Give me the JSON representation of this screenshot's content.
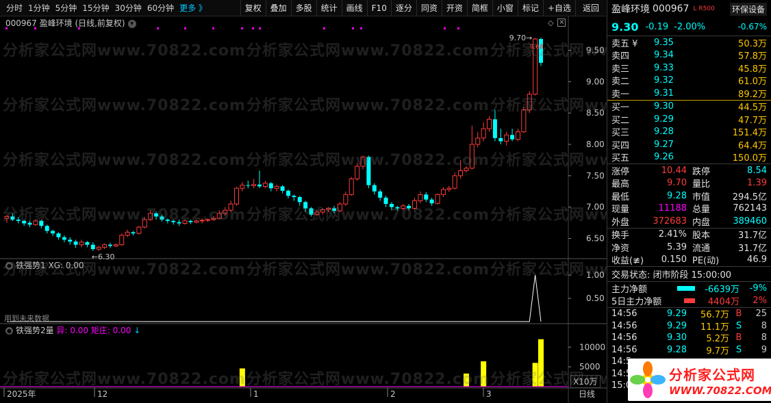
{
  "toolbar": {
    "periods": [
      "分时",
      "1分钟",
      "5分钟",
      "15分钟",
      "30分钟",
      "60分钟",
      "更多 》"
    ],
    "buttons": [
      "复权",
      "叠加",
      "多股",
      "统计",
      "画线",
      "F10",
      "逐分",
      "同资",
      "开资",
      "简框",
      "小窗",
      "标记",
      "+自选",
      "返回"
    ]
  },
  "chart_header": {
    "code_name": "000967 盈峰环境 (日线,前复权)",
    "dropdown_icon": "chevron-down-icon"
  },
  "watermark_text": "分析家公式网www.70822.com",
  "annotations": {
    "high": "9.70",
    "low": "6.30",
    "last": "9.68"
  },
  "indicator1": {
    "name": "铁强势1",
    "value_label": "XG: 0.00",
    "note": "用到未来数据",
    "axis": [
      "1.00",
      "0.50"
    ]
  },
  "indicator2": {
    "name": "铁强势2量",
    "v1": "异: 0.00",
    "v2": "矩庄: 0.00",
    "arrow": "↓",
    "axis": [
      "10000",
      "5000"
    ],
    "unit": "X10万"
  },
  "x_axis": {
    "labels": [
      "2025年",
      "12",
      "1",
      "2",
      "3"
    ],
    "period": "日线"
  },
  "colors": {
    "up": "#ff3c3c",
    "down": "#00ffff",
    "bg": "#000000",
    "volume": "#ffff00",
    "signal": "#ffffff",
    "accent": "#00c8ff"
  },
  "chart_data": {
    "type": "candlestick",
    "ylim": [
      6.2,
      9.8
    ],
    "y_ticks": [
      "9.50",
      "9.00",
      "8.50",
      "8.00",
      "7.50",
      "7.00",
      "6.50"
    ],
    "candles": [
      [
        6.82,
        6.85,
        6.75,
        6.88
      ],
      [
        6.85,
        6.8,
        6.78,
        6.9
      ],
      [
        6.8,
        6.78,
        6.74,
        6.84
      ],
      [
        6.78,
        6.74,
        6.7,
        6.8
      ],
      [
        6.75,
        6.72,
        6.68,
        6.78
      ],
      [
        6.72,
        6.78,
        6.7,
        6.8
      ],
      [
        6.78,
        6.7,
        6.66,
        6.8
      ],
      [
        6.7,
        6.62,
        6.58,
        6.72
      ],
      [
        6.62,
        6.58,
        6.54,
        6.64
      ],
      [
        6.58,
        6.52,
        6.48,
        6.6
      ],
      [
        6.52,
        6.48,
        6.44,
        6.55
      ],
      [
        6.48,
        6.45,
        6.4,
        6.52
      ],
      [
        6.45,
        6.4,
        6.35,
        6.48
      ],
      [
        6.4,
        6.44,
        6.36,
        6.48
      ],
      [
        6.44,
        6.4,
        6.36,
        6.46
      ],
      [
        6.4,
        6.33,
        6.3,
        6.44
      ],
      [
        6.33,
        6.36,
        6.3,
        6.38
      ],
      [
        6.36,
        6.4,
        6.33,
        6.42
      ],
      [
        6.4,
        6.38,
        6.35,
        6.43
      ],
      [
        6.38,
        6.4,
        6.36,
        6.42
      ],
      [
        6.4,
        6.55,
        6.38,
        6.58
      ],
      [
        6.55,
        6.6,
        6.52,
        6.64
      ],
      [
        6.6,
        6.58,
        6.55,
        6.62
      ],
      [
        6.58,
        6.68,
        6.56,
        6.7
      ],
      [
        6.68,
        6.8,
        6.66,
        6.84
      ],
      [
        6.8,
        6.9,
        6.78,
        6.95
      ],
      [
        6.9,
        6.85,
        6.8,
        6.93
      ],
      [
        6.85,
        6.8,
        6.77,
        6.88
      ],
      [
        6.8,
        6.78,
        6.74,
        6.82
      ],
      [
        6.78,
        6.76,
        6.72,
        6.8
      ],
      [
        6.76,
        6.74,
        6.7,
        6.8
      ],
      [
        6.74,
        6.78,
        6.72,
        6.8
      ],
      [
        6.78,
        6.76,
        6.73,
        6.8
      ],
      [
        6.76,
        6.78,
        6.74,
        6.8
      ],
      [
        6.78,
        6.79,
        6.74,
        6.82
      ],
      [
        6.79,
        6.8,
        6.76,
        6.82
      ],
      [
        6.8,
        6.82,
        6.78,
        6.86
      ],
      [
        6.82,
        6.9,
        6.8,
        6.95
      ],
      [
        6.9,
        6.95,
        6.86,
        7.0
      ],
      [
        6.95,
        7.05,
        6.92,
        7.1
      ],
      [
        7.05,
        7.3,
        7.02,
        7.32
      ],
      [
        7.3,
        7.35,
        7.25,
        7.4
      ],
      [
        7.35,
        7.34,
        7.3,
        7.42
      ],
      [
        7.34,
        7.36,
        7.3,
        7.45
      ],
      [
        7.36,
        7.33,
        7.3,
        7.58
      ],
      [
        7.33,
        7.38,
        7.3,
        7.42
      ],
      [
        7.38,
        7.3,
        7.25,
        7.4
      ],
      [
        7.3,
        7.33,
        7.25,
        7.36
      ],
      [
        7.33,
        7.26,
        7.22,
        7.35
      ],
      [
        7.26,
        7.18,
        7.14,
        7.28
      ],
      [
        7.18,
        7.16,
        7.1,
        7.2
      ],
      [
        7.16,
        7.08,
        7.02,
        7.18
      ],
      [
        7.08,
        6.98,
        6.92,
        7.1
      ],
      [
        6.98,
        6.88,
        6.85,
        7.0
      ],
      [
        6.88,
        6.92,
        6.85,
        6.95
      ],
      [
        6.92,
        6.96,
        6.88,
        6.98
      ],
      [
        6.96,
        6.98,
        6.92,
        7.0
      ],
      [
        6.98,
        6.94,
        6.9,
        7.02
      ],
      [
        6.94,
        7.05,
        6.92,
        7.08
      ],
      [
        7.05,
        7.2,
        7.02,
        7.25
      ],
      [
        7.2,
        7.45,
        7.18,
        7.48
      ],
      [
        7.45,
        7.65,
        7.42,
        7.7
      ],
      [
        7.65,
        7.8,
        7.6,
        7.82
      ],
      [
        7.8,
        7.35,
        7.3,
        7.82
      ],
      [
        7.35,
        7.25,
        7.2,
        7.38
      ],
      [
        7.25,
        7.15,
        7.1,
        7.28
      ],
      [
        7.15,
        7.05,
        7.0,
        7.18
      ],
      [
        7.05,
        7.0,
        6.95,
        7.08
      ],
      [
        7.0,
        6.98,
        6.94,
        7.02
      ],
      [
        6.98,
        7.02,
        6.95,
        7.05
      ],
      [
        7.02,
        6.98,
        6.95,
        7.05
      ],
      [
        6.98,
        7.1,
        6.96,
        7.15
      ],
      [
        7.1,
        7.2,
        7.06,
        7.25
      ],
      [
        7.2,
        7.12,
        7.08,
        7.24
      ],
      [
        7.12,
        7.06,
        7.02,
        7.15
      ],
      [
        7.06,
        7.2,
        7.04,
        7.22
      ],
      [
        7.2,
        7.28,
        7.16,
        7.32
      ],
      [
        7.28,
        7.3,
        7.24,
        7.34
      ],
      [
        7.3,
        7.5,
        7.28,
        7.55
      ],
      [
        7.5,
        7.58,
        7.45,
        7.75
      ],
      [
        7.58,
        7.62,
        7.55,
        7.65
      ],
      [
        7.62,
        8.0,
        7.6,
        8.3
      ],
      [
        8.0,
        8.1,
        7.95,
        8.2
      ],
      [
        8.1,
        8.25,
        8.05,
        8.35
      ],
      [
        8.25,
        8.4,
        8.2,
        8.45
      ],
      [
        8.4,
        8.1,
        8.05,
        8.55
      ],
      [
        8.1,
        8.05,
        8.0,
        8.25
      ],
      [
        8.05,
        8.15,
        7.98,
        8.2
      ],
      [
        8.15,
        8.08,
        8.05,
        8.25
      ],
      [
        8.08,
        8.2,
        8.05,
        8.25
      ],
      [
        8.2,
        8.55,
        8.18,
        8.6
      ],
      [
        8.55,
        8.8,
        8.5,
        8.85
      ],
      [
        8.8,
        9.68,
        8.78,
        9.7
      ],
      [
        9.68,
        9.3,
        9.25,
        9.7
      ]
    ],
    "indicator1_values": [
      0,
      0,
      0,
      0,
      0,
      0,
      0,
      0,
      0,
      0,
      0,
      0,
      0,
      0,
      0,
      0,
      0,
      0,
      0,
      0,
      0,
      0,
      0,
      0,
      0,
      0,
      0,
      0,
      0,
      0,
      0,
      0,
      0,
      0,
      0,
      0,
      0,
      0,
      0,
      0,
      0,
      0,
      0,
      0,
      0,
      0,
      0,
      0,
      0,
      0,
      0,
      0,
      0,
      0,
      0,
      0,
      0,
      0,
      0,
      0,
      0,
      0,
      0,
      0,
      0,
      0,
      0,
      0,
      0,
      0,
      0,
      0,
      0,
      0,
      0,
      0,
      0,
      0,
      0,
      0,
      0,
      0,
      0,
      0,
      0,
      0,
      0,
      0,
      0,
      0,
      0,
      0,
      1,
      0
    ],
    "indicator2_values": [
      0,
      0,
      0,
      0,
      0,
      0,
      0,
      0,
      0,
      0,
      0,
      0,
      0,
      0,
      0,
      0,
      0,
      0,
      0,
      0,
      0,
      0,
      0,
      0,
      0,
      0,
      0,
      0,
      0,
      0,
      0,
      0,
      0,
      0,
      0,
      0,
      0,
      0,
      0,
      0,
      0,
      4600,
      0,
      0,
      0,
      0,
      0,
      0,
      0,
      0,
      0,
      0,
      0,
      0,
      0,
      0,
      0,
      0,
      0,
      0,
      0,
      0,
      0,
      0,
      0,
      0,
      0,
      0,
      0,
      0,
      0,
      0,
      0,
      0,
      0,
      0,
      0,
      0,
      0,
      0,
      3300,
      0,
      0,
      6400,
      0,
      0,
      0,
      0,
      0,
      0,
      0,
      0,
      6000,
      12000,
      0
    ]
  },
  "quote": {
    "name": "盈峰环境",
    "code": "000967",
    "badge": "L R500",
    "price": "9.30",
    "change": "-0.19",
    "pct": "-2.00%",
    "sector": "环保设备",
    "sector_pct": "-0.67%",
    "asks": [
      {
        "label": "卖五 ¥",
        "price": "9.35",
        "vol": "50.3万"
      },
      {
        "label": "卖四",
        "price": "9.34",
        "vol": "57.8万"
      },
      {
        "label": "卖三",
        "price": "9.33",
        "vol": "45.8万"
      },
      {
        "label": "卖二",
        "price": "9.32",
        "vol": "61.0万"
      },
      {
        "label": "卖一",
        "price": "9.31",
        "vol": "89.2万"
      }
    ],
    "bids": [
      {
        "label": "买一",
        "price": "9.30",
        "vol": "44.5万"
      },
      {
        "label": "买二",
        "price": "9.29",
        "vol": "47.7万"
      },
      {
        "label": "买三",
        "price": "9.28",
        "vol": "151.4万"
      },
      {
        "label": "买四",
        "price": "9.27",
        "vol": "64.4万"
      },
      {
        "label": "买五",
        "price": "9.26",
        "vol": "150.0万"
      }
    ],
    "stats1": [
      {
        "k1": "涨停",
        "v1": "10.44",
        "c1": "red",
        "k2": "跌停",
        "v2": "8.54",
        "c2": "cyan"
      },
      {
        "k1": "最高",
        "v1": "9.70",
        "c1": "red",
        "k2": "量比",
        "v2": "1.39",
        "c2": "red"
      },
      {
        "k1": "最低",
        "v1": "9.28",
        "c1": "cyan",
        "k2": "市值",
        "v2": "294.5亿",
        "c2": "white"
      },
      {
        "k1": "现量",
        "v1": "11188",
        "c1": "mag",
        "k2": "总量",
        "v2": "762143",
        "c2": "white"
      },
      {
        "k1": "外盘",
        "v1": "372683",
        "c1": "red",
        "k2": "内盘",
        "v2": "389460",
        "c2": "cyan"
      }
    ],
    "stats2": [
      {
        "k1": "换手",
        "v1": "2.41%",
        "k2": "股本",
        "v2": "31.7亿"
      },
      {
        "k1": "净资",
        "v1": "5.39",
        "k2": "流通",
        "v2": "31.7亿"
      },
      {
        "k1": "收益(≢)",
        "v1": "0.150",
        "k2": "PE(动)",
        "v2": "46.9"
      }
    ],
    "status": "交易状态: 闭市阶段 15:00:00",
    "flows": [
      {
        "label": "主力净额",
        "bar_color": "#00ffff",
        "value": "-6639万",
        "pct": "-9%",
        "c": "cyan"
      },
      {
        "label": "5日主力净额",
        "bar_color": "#ff3c3c",
        "value": "4404万",
        "pct": "2%",
        "c": "red"
      }
    ],
    "ticks": [
      {
        "time": "14:56",
        "price": "9.29",
        "vol": "56.7万",
        "side": "B",
        "n": "25"
      },
      {
        "time": "14:56",
        "price": "9.29",
        "vol": "11.1万",
        "side": "S",
        "n": "8"
      },
      {
        "time": "14:56",
        "price": "9.30",
        "vol": "5.2万",
        "side": "B",
        "n": "8"
      },
      {
        "time": "14:56",
        "price": "9.28",
        "vol": "9.7万",
        "side": "S",
        "n": "9"
      },
      {
        "time": "14:5",
        "price": "",
        "vol": "",
        "side": "",
        "n": ""
      },
      {
        "time": "14:5",
        "price": "",
        "vol": "",
        "side": "",
        "n": ""
      },
      {
        "time": "15:0",
        "price": "",
        "vol": "",
        "side": "",
        "n": ""
      }
    ]
  },
  "logo": {
    "title": "分析家公式网",
    "url": "WWW.70822.COM"
  }
}
